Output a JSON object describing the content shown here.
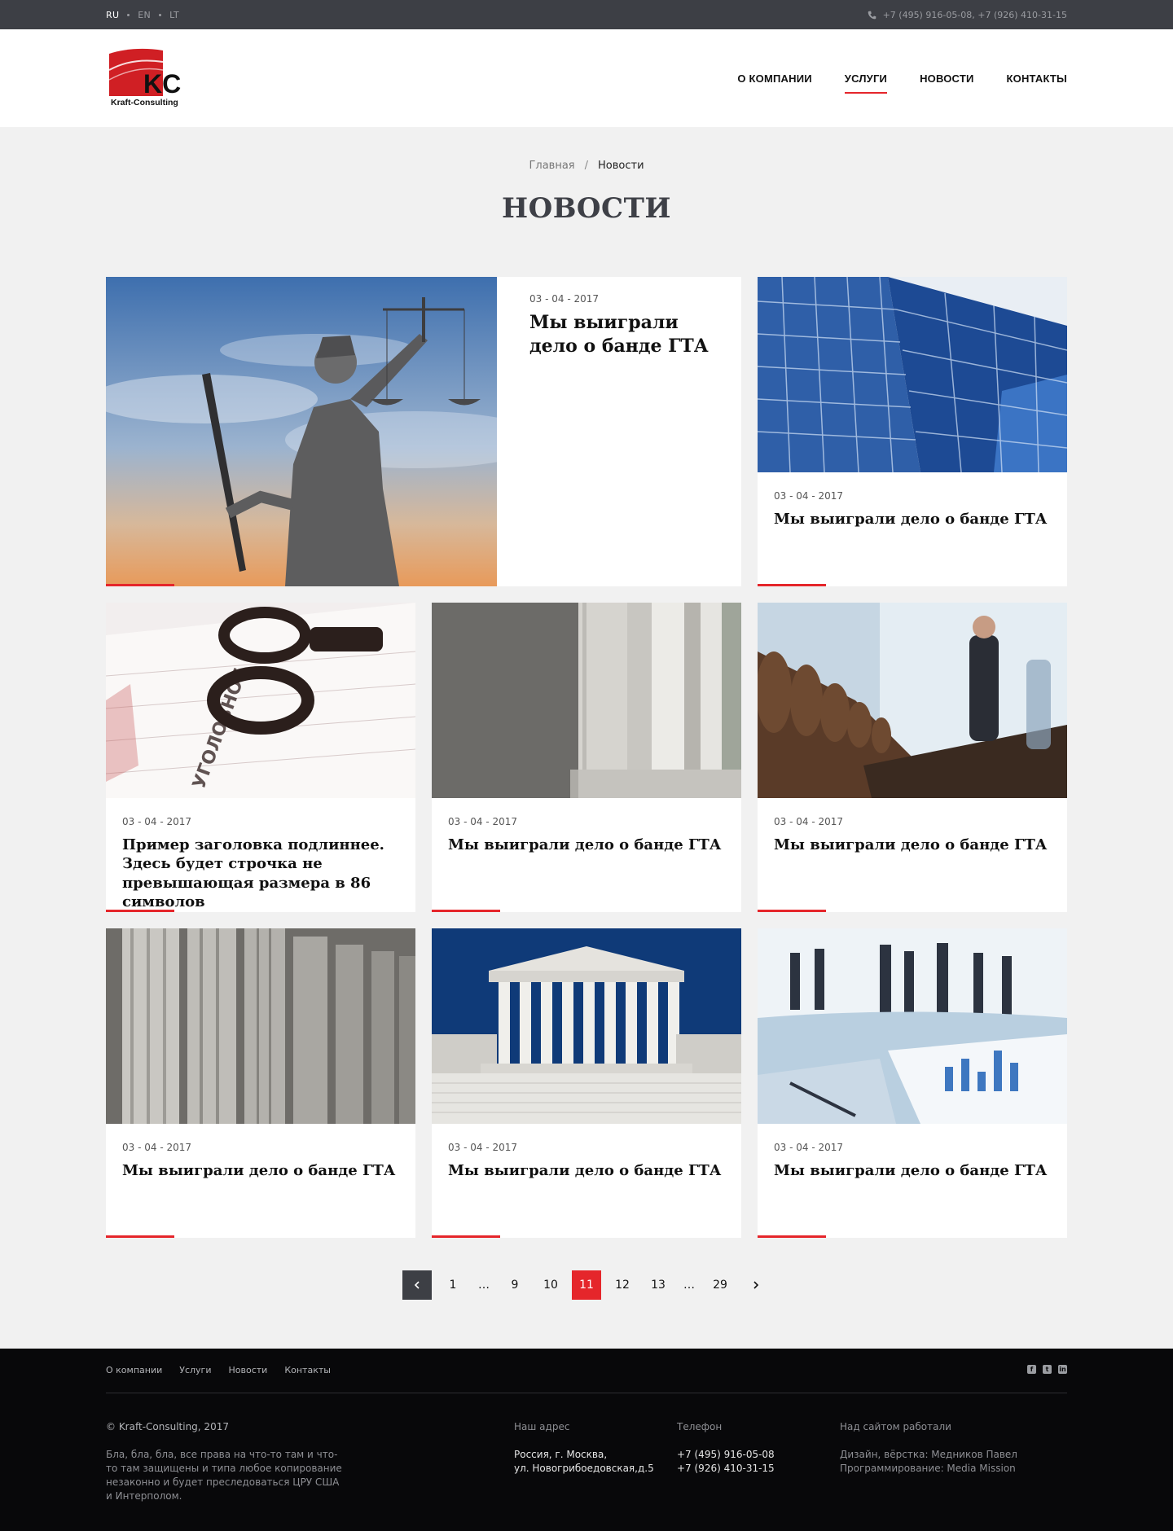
{
  "topbar": {
    "languages": [
      {
        "code": "RU",
        "active": true
      },
      {
        "code": "EN",
        "active": false
      },
      {
        "code": "LT",
        "active": false
      }
    ],
    "phones": "+7 (495) 916-05-08, +7 (926) 410-31-15"
  },
  "header": {
    "logo_text": "Kraft-Consulting",
    "logo_mark": "KC",
    "nav": [
      {
        "label": "О КОМПАНИИ",
        "active": false
      },
      {
        "label": "УСЛУГИ",
        "active": true
      },
      {
        "label": "НОВОСТИ",
        "active": false
      },
      {
        "label": "КОНТАКТЫ",
        "active": false
      }
    ]
  },
  "breadcrumb": {
    "home": "Главная",
    "current": "Новости"
  },
  "page_title": "НОВОСТИ",
  "news": [
    {
      "date": "03 - 04 - 2017",
      "title": "Мы выиграли дело о банде ГТА",
      "image": "justice-statue"
    },
    {
      "date": "03 - 04 - 2017",
      "title": "Мы выиграли дело о банде ГТА",
      "image": "glass-building"
    },
    {
      "date": "03 - 04 - 2017",
      "title": "Пример заголовка подлиннее. Здесь будет строчка не превышающая размера в 86 символов",
      "image": "handcuffs-document"
    },
    {
      "date": "03 - 04 - 2017",
      "title": "Мы выиграли дело о банде ГТА",
      "image": "marble-columns"
    },
    {
      "date": "03 - 04 - 2017",
      "title": "Мы выиграли дело о банде ГТА",
      "image": "meeting-room"
    },
    {
      "date": "03 - 04 - 2017",
      "title": "Мы выиграли дело о банде ГТА",
      "image": "columns-closeup"
    },
    {
      "date": "03 - 04 - 2017",
      "title": "Мы выиграли дело о банде ГТА",
      "image": "supreme-court"
    },
    {
      "date": "03 - 04 - 2017",
      "title": "Мы выиграли дело о банде ГТА",
      "image": "business-meeting"
    }
  ],
  "pagination": {
    "prev_icon": "chevron-left-icon",
    "next_icon": "chevron-right-icon",
    "pages": [
      "1",
      "…",
      "9",
      "10",
      "11",
      "12",
      "13",
      "…",
      "29"
    ],
    "current": "11"
  },
  "footer": {
    "nav": [
      "О компании",
      "Услуги",
      "Новости",
      "Контакты"
    ],
    "socials": [
      "facebook-icon",
      "twitter-icon",
      "linkedin-icon"
    ],
    "copyright": "© Kraft-Consulting, 2017",
    "disclaimer": "Бла, бла, бла, все права на что-то там и что-то там защищены и типа любое копирование незаконно и будет преследоваться ЦРУ США и Интерполом.",
    "address_heading": "Наш адрес",
    "address_line1": "Россия, г. Москва,",
    "address_line2": "ул. Новогрибоедовская,д.5",
    "phone_heading": "Телефон",
    "phone1": "+7 (495) 916-05-08",
    "phone2": "+7 (926) 410-31-15",
    "credits_heading": "Над сайтом работали",
    "credits_design": "Дизайн, вёрстка: Медников Павел",
    "credits_dev": "Программирование: Media Mission"
  },
  "colors": {
    "accent": "#e5262b",
    "dark": "#3d3f45",
    "footer": "#08080a"
  }
}
